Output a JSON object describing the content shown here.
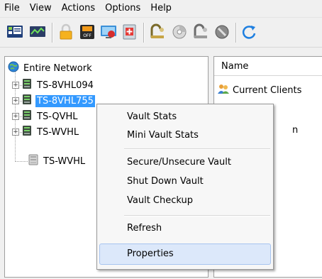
{
  "menubar": {
    "items": [
      "File",
      "View",
      "Actions",
      "Options",
      "Help"
    ]
  },
  "toolbar": {
    "icons": [
      "view-panes-icon",
      "monitor-chart-icon",
      "lock-icon",
      "power-off-icon",
      "network-screen-icon",
      "vault-plus-icon",
      "license-icon",
      "disc-icon",
      "key-icon",
      "shield-icon",
      "refresh-icon"
    ],
    "power_label": "OFF"
  },
  "tree": {
    "root_label": "Entire Network",
    "nodes": [
      {
        "label": "TS-8VHL094",
        "expander": "+"
      },
      {
        "label": "TS-8VHL755",
        "expander": "+"
      },
      {
        "label": "TS-QVHL",
        "expander": "+"
      },
      {
        "label": "TS-WVHL",
        "expander": "+"
      },
      {
        "label": "TS-WVHL",
        "expander": ""
      }
    ]
  },
  "list": {
    "column_name": "Name",
    "rows": [
      "Current Clients"
    ],
    "partial_text": "n"
  },
  "context_menu": {
    "items": [
      "Vault Stats",
      "Mini Vault Stats",
      "Secure/Unsecure Vault",
      "Shut Down Vault",
      "Vault Checkup",
      "Refresh",
      "Properties"
    ]
  },
  "colors": {
    "selection": "#3399ff",
    "menu_hover": "#dce8fa",
    "toolbar_accent": "#f5a623"
  }
}
